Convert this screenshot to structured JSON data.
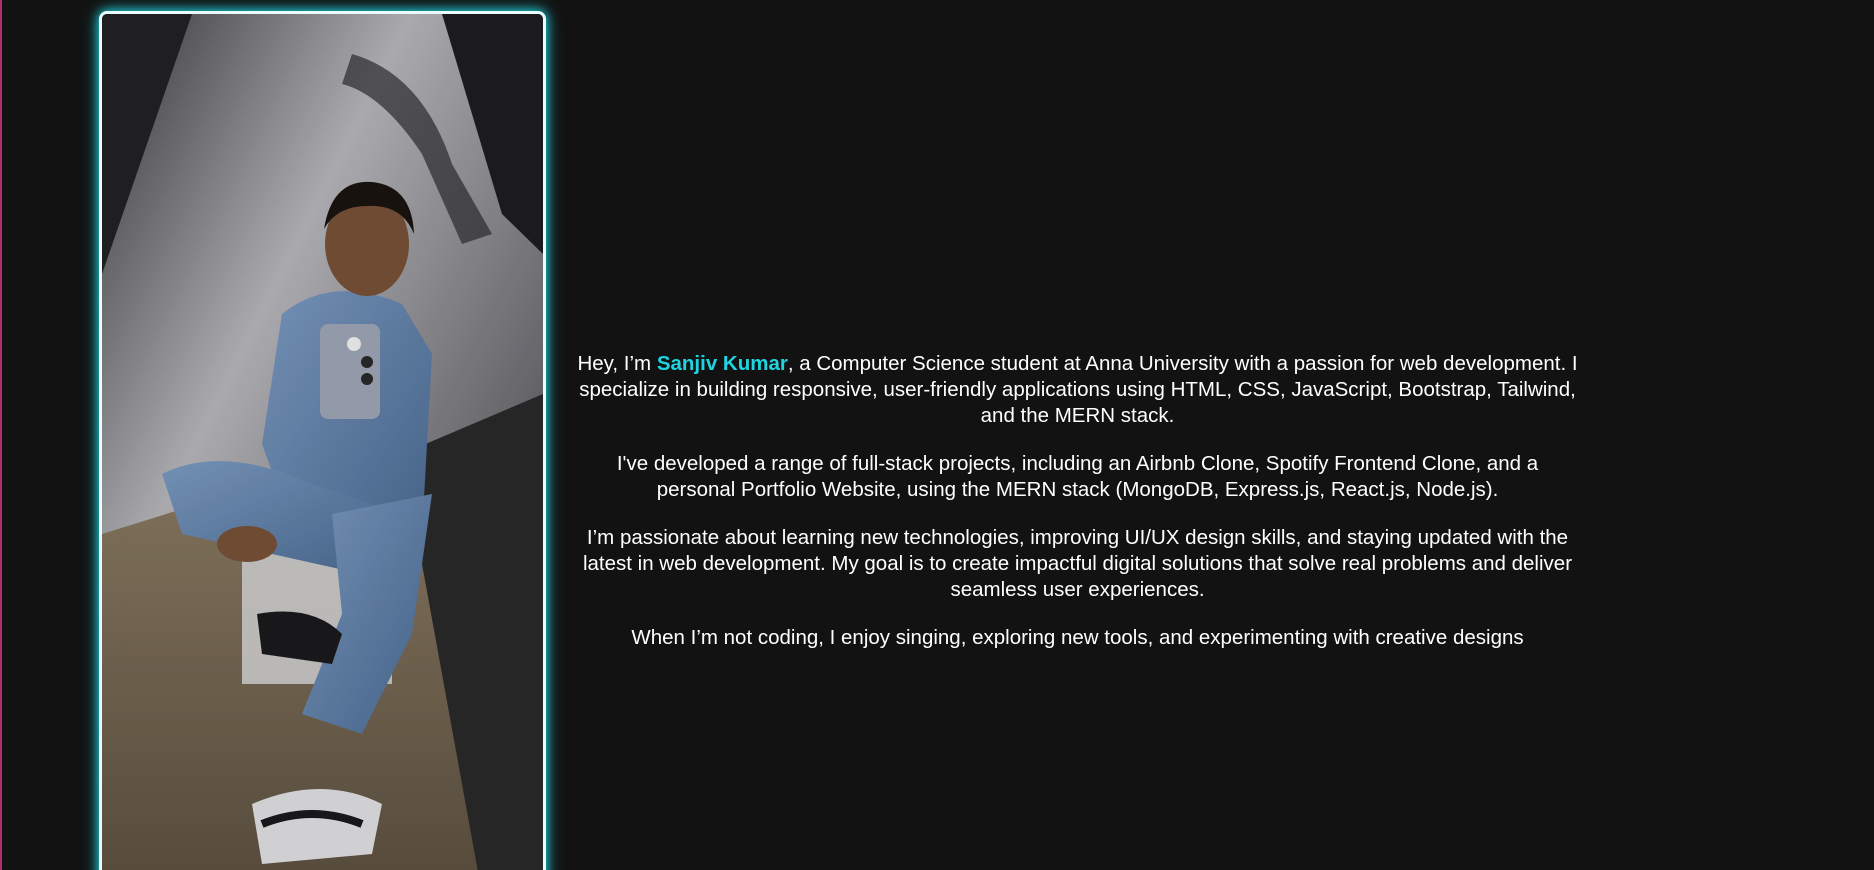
{
  "about": {
    "intro_prefix": "Hey, I’m ",
    "name": "Sanjiv Kumar",
    "intro_suffix": ", a Computer Science student at Anna University with a passion for web development. I specialize in building responsive, user-friendly applications using HTML, CSS, JavaScript, Bootstrap, Tailwind, and the MERN stack.",
    "projects": "I've developed a range of full-stack projects, including an Airbnb Clone, Spotify Frontend Clone, and a personal Portfolio Website, using the MERN stack (MongoDB, Express.js, React.js, Node.js).",
    "passion": "I’m passionate about learning new technologies, improving UI/UX design skills, and staying updated with the latest in web development. My goal is to create impactful digital solutions that solve real problems and deliver seamless user experiences.",
    "hobbies": "When I’m not coding, I enjoy singing, exploring new tools, and experimenting with creative designs"
  },
  "photo": {
    "icon": "profile-photo"
  },
  "colors": {
    "background": "#121212",
    "accent": "#1fd4e0",
    "text": "#ffffff",
    "edge": "#b0306e"
  }
}
